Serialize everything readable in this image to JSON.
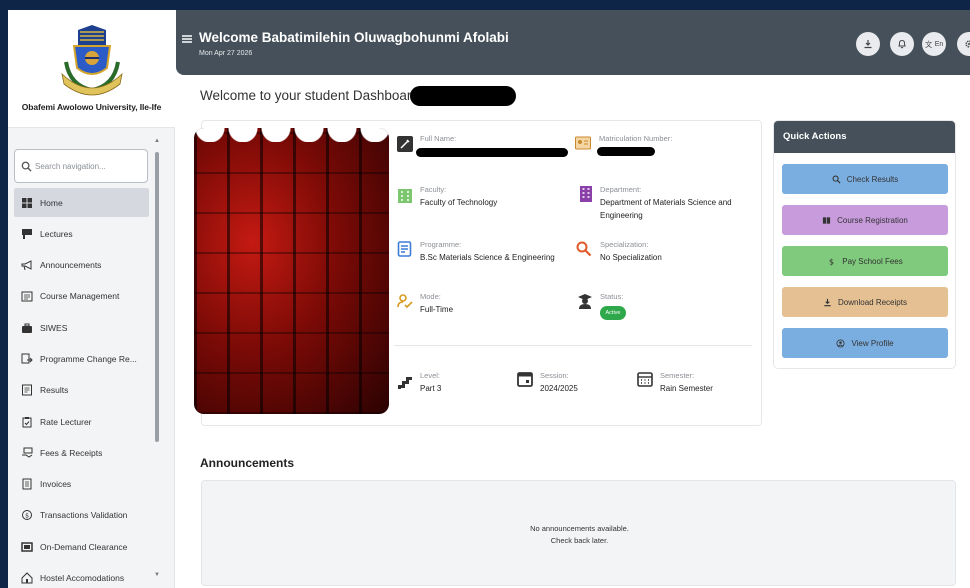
{
  "sidebar": {
    "university": "Obafemi Awolowo University, Ile-Ife",
    "search_placeholder": "Search navigation...",
    "items": [
      {
        "label": "Home",
        "icon": "home-icon",
        "active": true
      },
      {
        "label": "Lectures",
        "icon": "lectern-icon"
      },
      {
        "label": "Announcements",
        "icon": "megaphone-icon"
      },
      {
        "label": "Course Management",
        "icon": "calendar-list-icon"
      },
      {
        "label": "SIWES",
        "icon": "briefcase-icon"
      },
      {
        "label": "Programme Change Re...",
        "icon": "swap-document-icon"
      },
      {
        "label": "Results",
        "icon": "results-document-icon"
      },
      {
        "label": "Rate Lecturer",
        "icon": "clipboard-icon"
      },
      {
        "label": "Fees & Receipts",
        "icon": "hand-money-icon"
      },
      {
        "label": "Invoices",
        "icon": "invoice-icon"
      },
      {
        "label": "Transactions Validation",
        "icon": "coin-check-icon"
      },
      {
        "label": "On-Demand Clearance",
        "icon": "clearance-icon"
      },
      {
        "label": "Hostel Accomodations",
        "icon": "hostel-icon"
      }
    ]
  },
  "header": {
    "title": "Welcome Babatimilehin Oluwagbohunmi Afolabi",
    "date": "Mon Apr 27 2026",
    "lang_label": "En"
  },
  "main": {
    "dashboard_title": "Welcome to your student Dashboard",
    "profile": {
      "full_name_label": "Full Name:",
      "matric_label": "Matriculation Number:",
      "faculty_label": "Faculty:",
      "faculty_value": "Faculty of Technology",
      "department_label": "Department:",
      "department_value_1": "Department of Materials Science and",
      "department_value_2": "Engineering",
      "programme_label": "Programme:",
      "programme_value": "B.Sc Materials Science & Engineering",
      "specialization_label": "Specialization:",
      "specialization_value": "No Specialization",
      "mode_label": "Mode:",
      "mode_value": "Full-Time",
      "status_label": "Status:",
      "status_value": "Active",
      "level_label": "Level:",
      "level_value": "Part 3",
      "session_label": "Session:",
      "session_value": "2024/2025",
      "semester_label": "Semester:",
      "semester_value": "Rain Semester"
    },
    "quick_actions": {
      "title": "Quick Actions",
      "buttons": [
        {
          "label": "Check Results",
          "color": "#7baee0",
          "icon": "search-icon"
        },
        {
          "label": "Course Registration",
          "color": "#c79bdc",
          "icon": "book-icon"
        },
        {
          "label": "Pay School Fees",
          "color": "#7fca7c",
          "icon": "dollar-icon"
        },
        {
          "label": "Download Receipts",
          "color": "#e4c093",
          "icon": "download-icon"
        },
        {
          "label": "View Profile",
          "color": "#7baee0",
          "icon": "user-circle-icon"
        }
      ]
    },
    "announcements": {
      "title": "Announcements",
      "empty_line1": "No announcements available.",
      "empty_line2": "Check back later."
    }
  }
}
